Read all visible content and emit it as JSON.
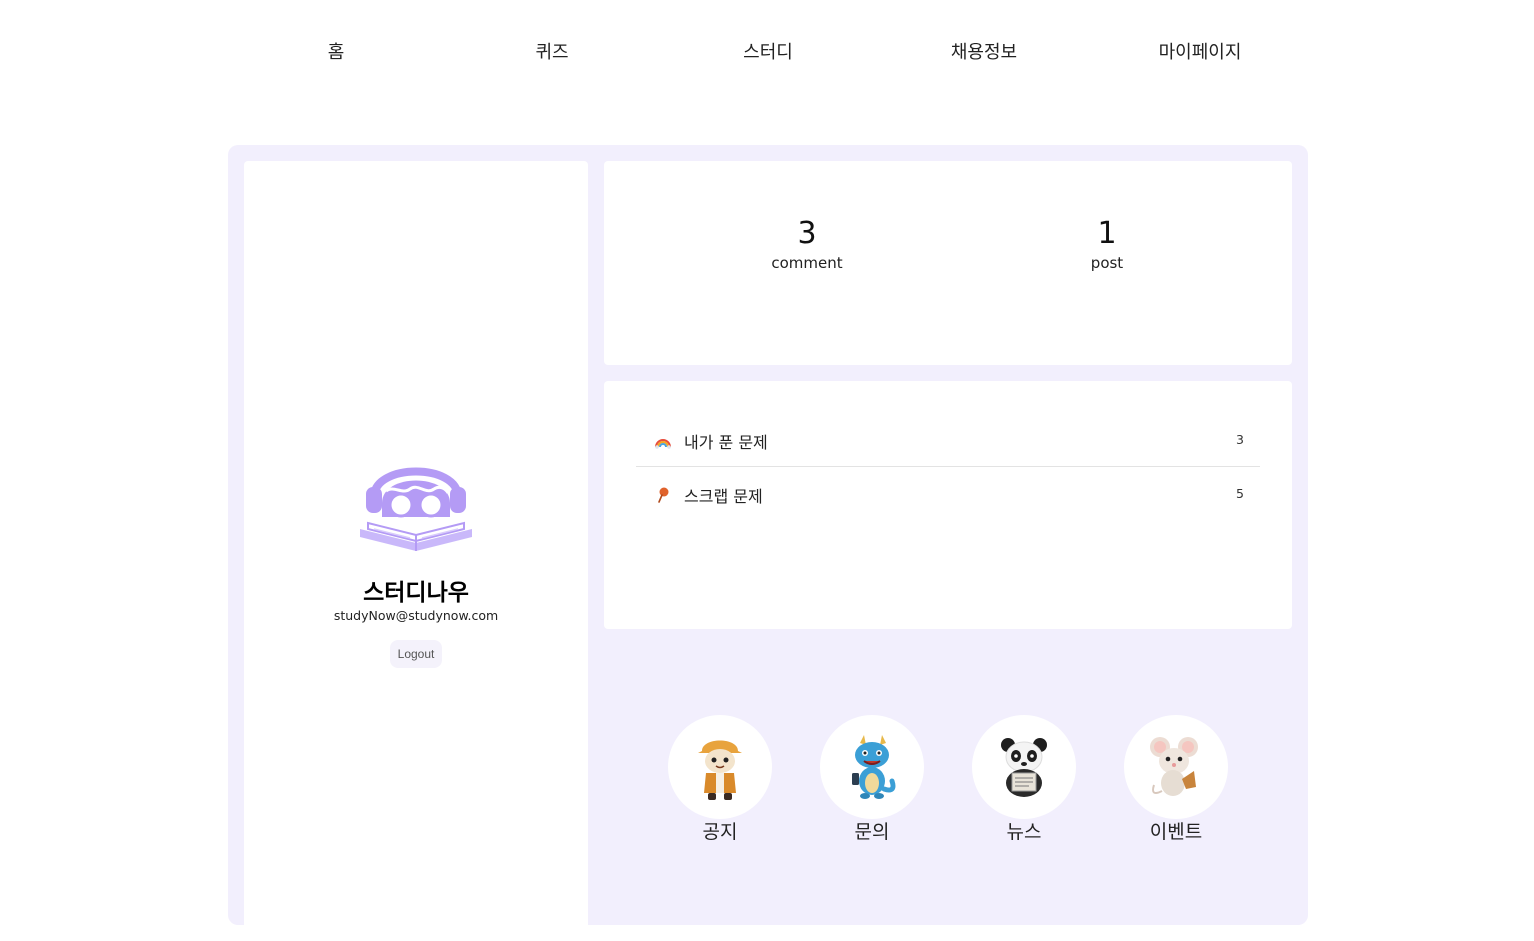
{
  "nav": {
    "items": [
      {
        "label": "홈"
      },
      {
        "label": "퀴즈"
      },
      {
        "label": "스터디"
      },
      {
        "label": "채용정보"
      },
      {
        "label": "마이페이지"
      }
    ]
  },
  "profile": {
    "name": "스터디나우",
    "email": "studyNow@studynow.com",
    "logout_label": "Logout",
    "avatar_icon": "reader-with-headphones-icon",
    "accent_color": "#b49bf5"
  },
  "stats": [
    {
      "value": "3",
      "label": "comment"
    },
    {
      "value": "1",
      "label": "post"
    }
  ],
  "quiz_list": [
    {
      "icon": "rainbow-icon",
      "label": "내가 푼 문제",
      "count": "3"
    },
    {
      "icon": "pushpin-icon",
      "label": "스크랩 문제",
      "count": "5"
    }
  ],
  "menu": [
    {
      "icon": "explorer-mascot-icon",
      "label": "공지"
    },
    {
      "icon": "dragon-mascot-icon",
      "label": "문의"
    },
    {
      "icon": "panda-mascot-icon",
      "label": "뉴스"
    },
    {
      "icon": "mouse-mascot-icon",
      "label": "이벤트"
    }
  ],
  "colors": {
    "background_panel": "#f2effd",
    "card": "#ffffff",
    "accent": "#b49bf5"
  }
}
